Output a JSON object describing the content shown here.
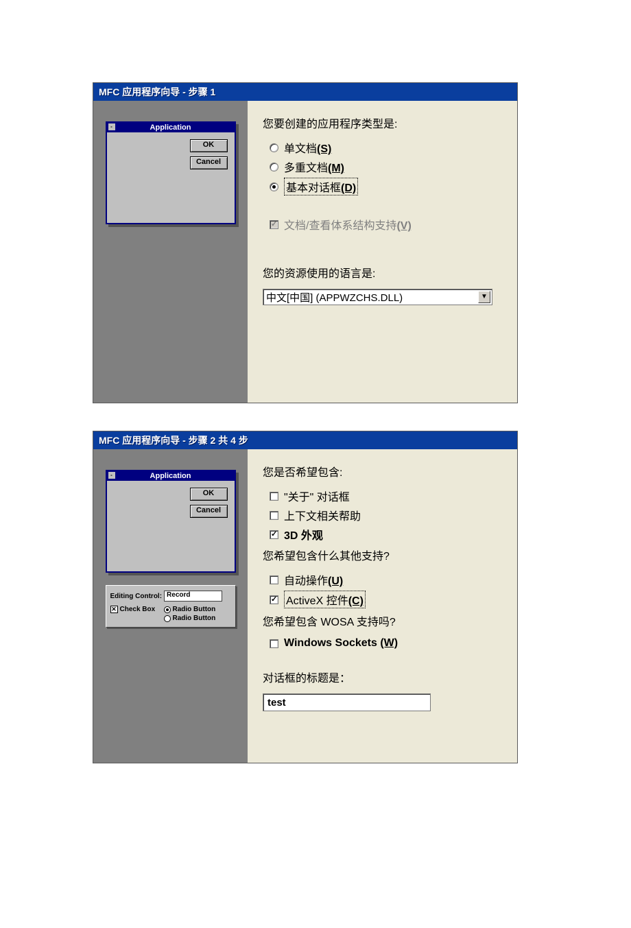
{
  "step1": {
    "title": "MFC 应用程序向导 - 步骤 1",
    "preview_title": "Application",
    "preview_ok": "OK",
    "preview_cancel": "Cancel",
    "question1": "您要创建的应用程序类型是:",
    "radio_single": "单文档",
    "radio_single_key": "(S)",
    "radio_multi": "多重文档",
    "radio_multi_key": "(M)",
    "radio_dialog": "基本对话框",
    "radio_dialog_key": "(D)",
    "docview": "文档/查看体系结构支持",
    "docview_key": "(V)",
    "question2": "您的资源使用的语言是:",
    "language_value": "中文[中国] (APPWZCHS.DLL)"
  },
  "step2": {
    "title": "MFC 应用程序向导 - 步骤 2 共 4 步",
    "preview_title": "Application",
    "preview_ok": "OK",
    "preview_cancel": "Cancel",
    "panel_editing": "Editing Control:",
    "panel_record": "Record",
    "panel_checkbox": "Check Box",
    "panel_radio": "Radio Button",
    "q1": "您是否希望包含:",
    "chk_about": "\"关于\" 对话框",
    "chk_ctx": "上下文相关帮助",
    "chk_3d": "3D 外观",
    "q2": "您希望包含什么其他支持?",
    "chk_auto": "自动操作",
    "chk_auto_key": "(U)",
    "chk_activex": "ActiveX 控件",
    "chk_activex_key": "(C)",
    "q3": "您希望包含 WOSA 支持吗?",
    "chk_sockets": "Windows Sockets ",
    "chk_sockets_key": "(W)",
    "q4": "对话框的标题是：",
    "title_value": "test"
  }
}
